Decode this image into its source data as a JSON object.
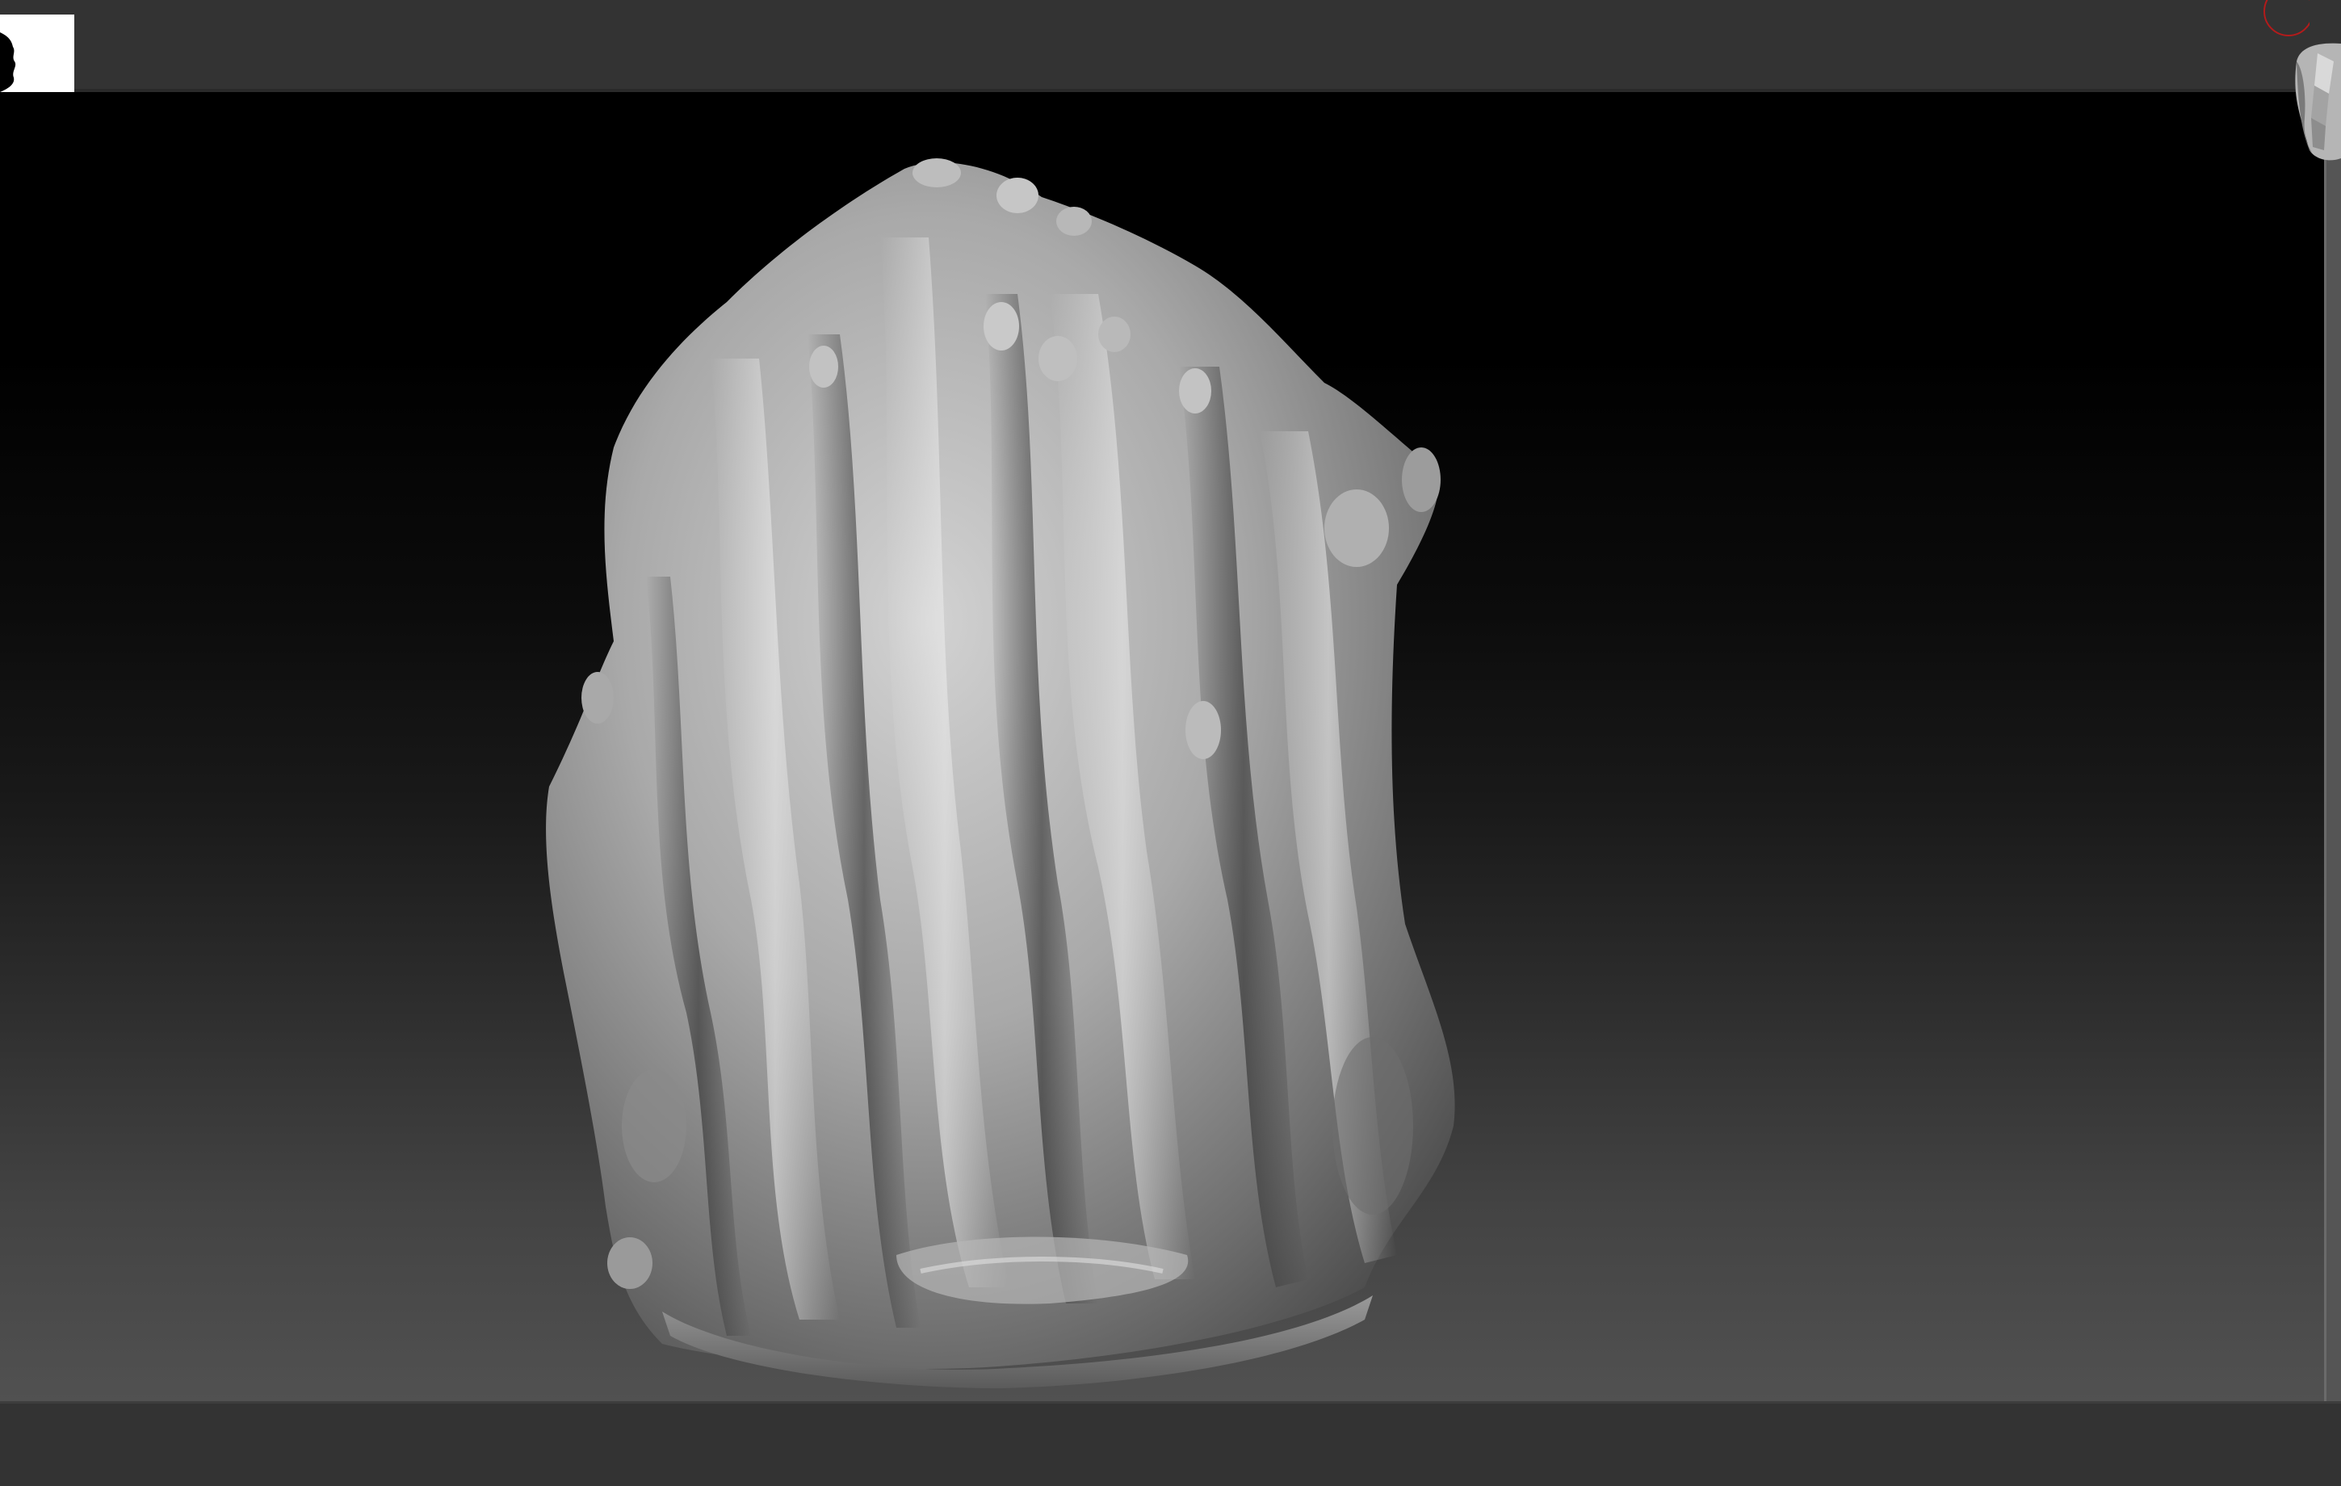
{
  "app": {
    "name": "",
    "colors": {
      "interface_bg": "#333333",
      "canvas_top": "#000000",
      "canvas_bottom": "#515151",
      "mesh_light": "#cfcfcf",
      "mesh_mid": "#8e8e8e",
      "mesh_dark": "#3e3e3e",
      "indicator_red": "#b31b1b"
    }
  },
  "toolbar": {
    "brush_thumbnail": {
      "icon": "alpha-brush-icon"
    },
    "floor_indicator": {
      "icon": "floor-circle-icon"
    }
  },
  "viewport": {
    "model": {
      "icon": "sculpted-mesh"
    },
    "navigation": {
      "icon": "head-navigation-gizmo-icon"
    }
  }
}
